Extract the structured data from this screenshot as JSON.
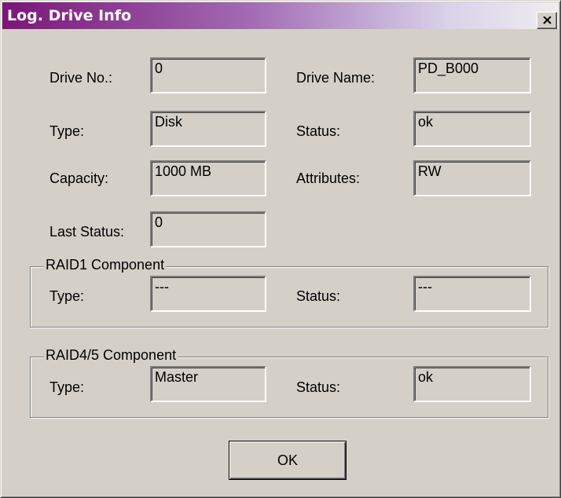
{
  "window": {
    "title": "Log. Drive Info",
    "close_icon": "close-icon"
  },
  "info": {
    "drive_no_label": "Drive No.:",
    "drive_no_value": "0",
    "drive_name_label": "Drive Name:",
    "drive_name_value": "PD_B000",
    "type_label": "Type:",
    "type_value": "Disk",
    "status_label": "Status:",
    "status_value": "ok",
    "capacity_label": "Capacity:",
    "capacity_value": "1000 MB",
    "attributes_label": "Attributes:",
    "attributes_value": "RW",
    "last_status_label": "Last Status:",
    "last_status_value": "0"
  },
  "raid1": {
    "title": "RAID1 Component",
    "type_label": "Type:",
    "type_value": "---",
    "status_label": "Status:",
    "status_value": "---"
  },
  "raid45": {
    "title": "RAID4/5 Component",
    "type_label": "Type:",
    "type_value": "Master",
    "status_label": "Status:",
    "status_value": "ok"
  },
  "buttons": {
    "ok": "OK"
  }
}
